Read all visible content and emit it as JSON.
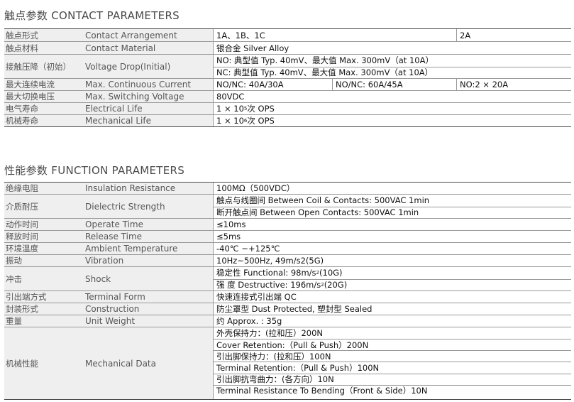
{
  "contact": {
    "title": "触点参数 CONTACT PARAMETERS",
    "rows": [
      {
        "cn": "触点形式",
        "en": "Contact Arrangement",
        "lines": [
          [
            "1A、1B、1C",
            "2A"
          ]
        ]
      },
      {
        "cn": "触点材料",
        "en": "Contact Material",
        "lines": [
          [
            "银合金 Silver Alloy"
          ]
        ]
      },
      {
        "cn": "接触压降（初始）",
        "en": "Voltage Drop(Initial)",
        "lines": [
          [
            "NO: 典型值 Typ. 40mV、最大值 Max. 300mV（at 10A）"
          ],
          [
            "NC: 典型值 Typ. 40mV、最大值 Max. 300mV（at 10A）"
          ]
        ]
      },
      {
        "cn": "最大连续电流",
        "en": "Max. Continuous Current",
        "lines": [
          [
            "NO/NC: 40A/30A",
            "NO/NC: 60A/45A",
            "NO:2 × 20A"
          ]
        ]
      },
      {
        "cn": "最大切换电压",
        "en": "Max. Switching Voltage",
        "lines": [
          [
            "80VDC"
          ]
        ]
      },
      {
        "cn": "电气寿命",
        "en": "Electrical Life",
        "lines": [
          [
            "1 × 10^5 次 OPS"
          ]
        ]
      },
      {
        "cn": "机械寿命",
        "en": "Mechanical Life",
        "lines": [
          [
            "1 × 10^6 次 OPS"
          ]
        ]
      }
    ]
  },
  "function": {
    "title": "性能参数 FUNCTION PARAMETERS",
    "rows": [
      {
        "cn": "绝缘电阻",
        "en": "Insulation Resistance",
        "lines": [
          [
            "100MΩ（500VDC）"
          ]
        ]
      },
      {
        "cn": "介质耐压",
        "en": "Dielectric Strength",
        "lines": [
          [
            "触点与线圈间 Between Coil & Contacts:  500VAC 1min"
          ],
          [
            "断开触点间 Between Open Contacts: 500VAC 1min"
          ]
        ]
      },
      {
        "cn": "动作时间",
        "en": "Operate Time",
        "lines": [
          [
            "≤10ms"
          ]
        ]
      },
      {
        "cn": "释放时间",
        "en": "Release Time",
        "lines": [
          [
            "≤5ms"
          ]
        ]
      },
      {
        "cn": "环境温度",
        "en": "Ambient Temperature",
        "lines": [
          [
            "-40℃ ~+125℃"
          ]
        ]
      },
      {
        "cn": "振动",
        "en": "Vibration",
        "lines": [
          [
            "10Hz~500Hz,  49m/s2(5G)"
          ]
        ]
      },
      {
        "cn": "冲击",
        "en": "Shock",
        "lines": [
          [
            "稳定性 Functional: 98m/s^2 (10G)"
          ],
          [
            "强  度 Destructive: 196m/s^2 (20G)"
          ]
        ]
      },
      {
        "cn": "引出端方式",
        "en": "Terminal Form",
        "lines": [
          [
            "快速连接式引出端 QC"
          ]
        ]
      },
      {
        "cn": "封装形式",
        "en": "Construction",
        "lines": [
          [
            "防尘罩型 Dust Protected,  塑封型 Sealed"
          ]
        ]
      },
      {
        "cn": "重量",
        "en": "Unit Weight",
        "lines": [
          [
            "约 Approx. : 35g"
          ]
        ]
      },
      {
        "cn": "机械性能",
        "en": "Mechanical Data",
        "lines": [
          [
            "外壳保持力：(拉和压）200N"
          ],
          [
            "Cover Retention:（Pull & Push）200N"
          ],
          [
            "引出脚保持力：(拉和压）100N"
          ],
          [
            "Terminal Retention:（Pull & Push）100N"
          ],
          [
            "引出脚抗弯曲力：(各方向）10N"
          ],
          [
            "Terminal Resistance To Bending（Front & Side）10N"
          ]
        ]
      }
    ]
  }
}
